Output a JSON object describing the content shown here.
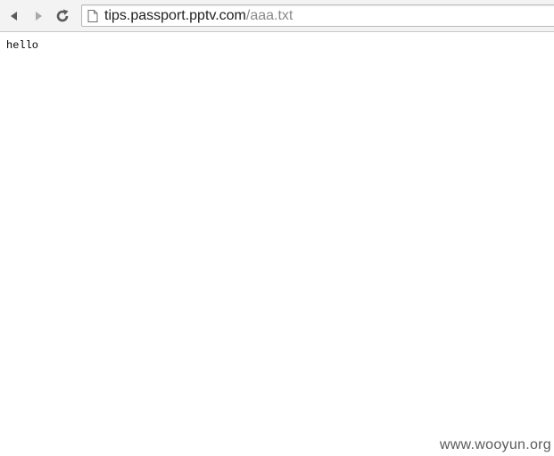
{
  "browser": {
    "url_host": "tips.passport.pptv.com",
    "url_path": "/aaa.txt",
    "icons": {
      "back": "back-arrow-icon",
      "forward": "forward-arrow-icon",
      "reload": "reload-icon",
      "page": "page-icon"
    }
  },
  "page": {
    "body_text": "hello"
  },
  "watermark": {
    "text": "www.wooyun.org"
  },
  "colors": {
    "toolbar_bg": "#f3f3f3",
    "url_host": "#1f1f1f",
    "url_path": "#8a8a8a"
  }
}
